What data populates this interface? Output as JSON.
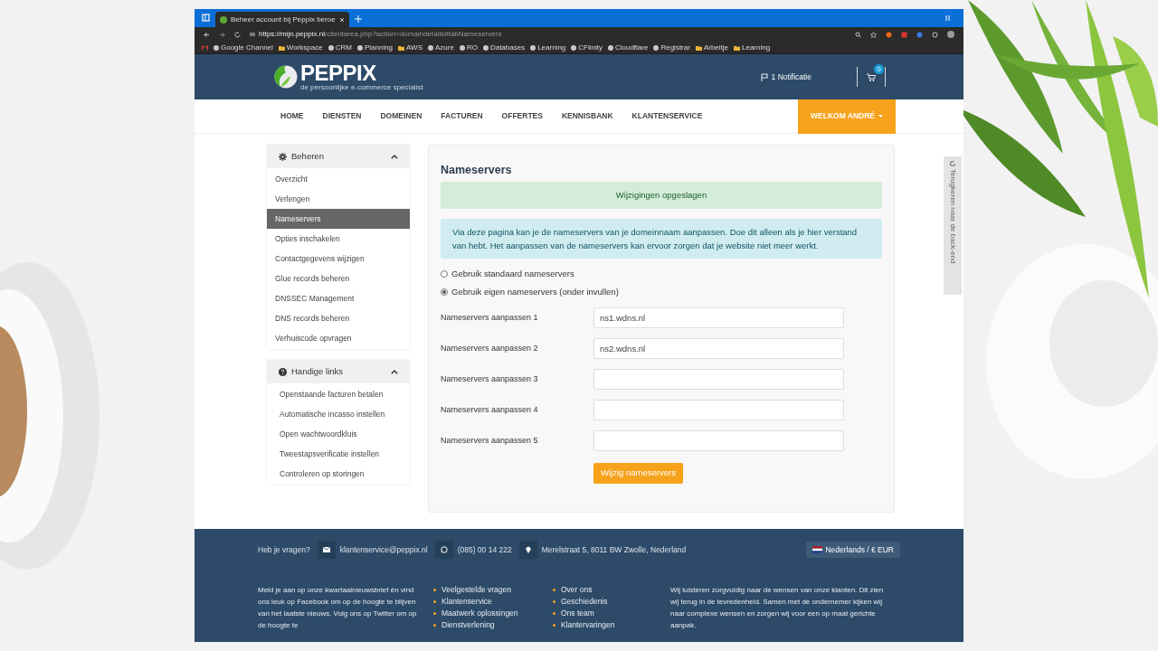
{
  "browser": {
    "tab_title": "Beheer account bij Peppix beroe",
    "url_host": "https://mijn.peppix.nl",
    "url_path": "/clientarea.php?action=domaindetails#tabNameservers",
    "bookmarks": [
      {
        "label": "Google Channel",
        "kind": "site"
      },
      {
        "label": "Workspace",
        "kind": "folder"
      },
      {
        "label": "CRM",
        "kind": "site"
      },
      {
        "label": "Planning",
        "kind": "site"
      },
      {
        "label": "AWS",
        "kind": "folder"
      },
      {
        "label": "Azure",
        "kind": "site"
      },
      {
        "label": "RO",
        "kind": "site"
      },
      {
        "label": "Databases",
        "kind": "site"
      },
      {
        "label": "Learning",
        "kind": "site"
      },
      {
        "label": "CFlinity",
        "kind": "site"
      },
      {
        "label": "Cloudflare",
        "kind": "site"
      },
      {
        "label": "Registrar",
        "kind": "site"
      },
      {
        "label": "Arbeitje",
        "kind": "folder"
      },
      {
        "label": "Learning",
        "kind": "folder"
      }
    ]
  },
  "header": {
    "logo": "PEPPIX",
    "tagline": "de persoonlijke e-commerce specialist",
    "notification": "1 Notificatie",
    "cart_count": "0"
  },
  "nav": {
    "items": [
      "HOME",
      "DIENSTEN",
      "DOMEINEN",
      "FACTUREN",
      "OFFERTES",
      "KENNISBANK",
      "KLANTENSERVICE"
    ],
    "user_menu": "WELKOM ANDRÉ"
  },
  "sidebar": [
    {
      "title": "Beheren",
      "kind": "settings",
      "expanded": true,
      "items": [
        {
          "label": "Overzicht",
          "selected": false
        },
        {
          "label": "Verlengen",
          "selected": false
        },
        {
          "label": "Nameservers",
          "selected": true
        },
        {
          "label": "Opties inschakelen",
          "selected": false
        },
        {
          "label": "Contactgegevens wijzigen",
          "selected": false
        },
        {
          "label": "Glue records beheren",
          "selected": false
        },
        {
          "label": "DNSSEC Management",
          "selected": false
        },
        {
          "label": "DNS records beheren",
          "selected": false
        },
        {
          "label": "Verhuiscode opvragen",
          "selected": false
        }
      ]
    },
    {
      "title": "Handige links",
      "kind": "help",
      "expanded": true,
      "items": [
        {
          "label": "Openstaande facturen betalen",
          "selected": false
        },
        {
          "label": "Automatische incasso instellen",
          "selected": false
        },
        {
          "label": "Open wachtwoordkluis",
          "selected": false
        },
        {
          "label": "Tweestapsverificatie instellen",
          "selected": false
        },
        {
          "label": "Controleren op storingen",
          "selected": false
        }
      ]
    }
  ],
  "content": {
    "title": "Nameservers",
    "success": "Wijzigingen opgeslagen",
    "info": "Via deze pagina kan je de nameservers van je domeinnaam aanpassen. Doe dit alleen als je hier verstand van hebt. Het aanpassen van de nameservers kan ervoor zorgen dat je website niet meer werkt.",
    "radios": [
      {
        "label": "Gebruik standaard nameservers",
        "selected": false
      },
      {
        "label": "Gebruik eigen nameservers (onder invullen)",
        "selected": true
      }
    ],
    "fields": [
      {
        "label": "Nameservers aanpassen 1",
        "value": "ns1.wdns.nl"
      },
      {
        "label": "Nameservers aanpassen 2",
        "value": "ns2.wdns.nl"
      },
      {
        "label": "Nameservers aanpassen 3"
      },
      {
        "label": "Nameservers aanpassen 4"
      },
      {
        "label": "Nameservers aanpassen 5"
      }
    ],
    "submit": "Wijzig nameservers"
  },
  "side_tab": "Terugkeren naar de back-end",
  "footer": {
    "question": "Heb je vragen?",
    "contacts": [
      {
        "kind": "email",
        "text": "klantenservice@peppix.nl"
      },
      {
        "kind": "whatsapp",
        "text": "(085) 00 14 222"
      },
      {
        "kind": "location",
        "text": "Merelstraat 5, 8011 BW Zwolle, Nederland"
      }
    ],
    "language": "Nederlands / € EUR",
    "newsletter": "Meld je aan op onze kwartaalnieuwsbrief én vind ons leuk op Facebook om op de hoogte te blijven van het laatste nieuws. Volg ons op Twitter om op de hoogte te",
    "links_1": [
      "Veelgestelde vragen",
      "Klantenservice",
      "Maatwerk oplossingen",
      "Dienstverlening"
    ],
    "links_2": [
      "Over ons",
      "Geschiedenis",
      "Ons team",
      "Klantervaringen"
    ],
    "about": "Wij luisteren zorgvuldig naar de wensen van onze klanten. Dit zien wij terug in de tevredenheid. Samen met de ondernemer kijken wij naar complexe wensen en zorgen wij voor een op maat gerichte aanpak."
  }
}
